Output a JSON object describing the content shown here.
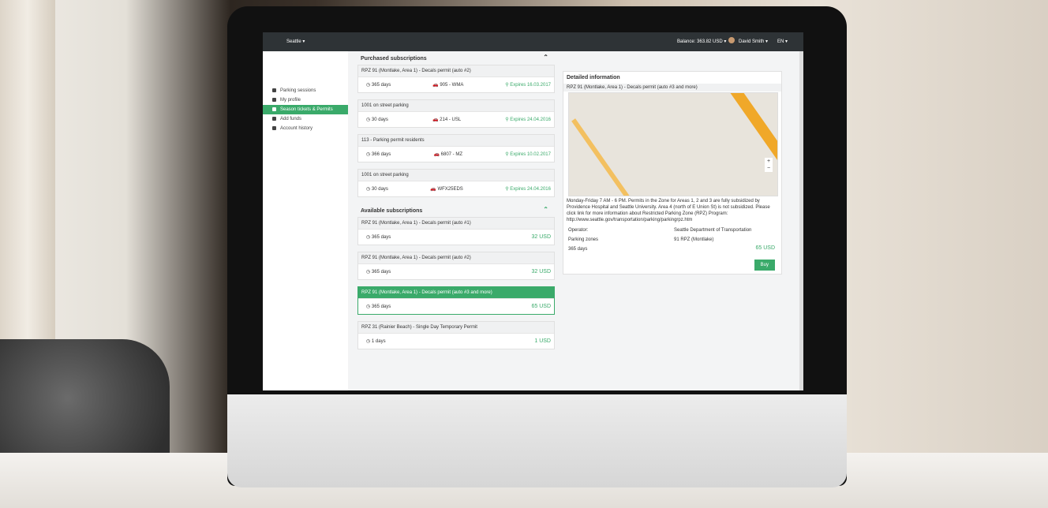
{
  "topbar": {
    "balance": "Balance: 363.82 USD ▾",
    "user": "David Smith ▾",
    "lang": "EN ▾",
    "city": "Seattle ▾"
  },
  "sidebar": {
    "items": [
      {
        "label": "Parking sessions",
        "icon": "car-icon"
      },
      {
        "label": "My profile",
        "icon": "user-icon"
      },
      {
        "label": "Season tickets & Permits",
        "icon": "ticket-icon",
        "active": true
      },
      {
        "label": "Add funds",
        "icon": "money-icon"
      },
      {
        "label": "Account history",
        "icon": "calendar-icon"
      }
    ]
  },
  "purchased": {
    "title": "Purchased subscriptions",
    "items": [
      {
        "name": "RPZ 91 (Montlake, Area 1) - Decals permit (auto #2)",
        "days": "365 days",
        "plate": "905 - WMA",
        "exp": "Expires 16.03.2017"
      },
      {
        "name": "1001 on street parking",
        "days": "30 days",
        "plate": "214 - USL",
        "exp": "Expires 24.04.2016"
      },
      {
        "name": "113 - Parking permit residents",
        "days": "366 days",
        "plate": "6807 - MZ",
        "exp": "Expires 10.02.2017"
      },
      {
        "name": "1001 on street parking",
        "days": "30 days",
        "plate": "WFX25EDS",
        "exp": "Expires 24.04.2016"
      }
    ]
  },
  "available": {
    "title": "Available subscriptions",
    "items": [
      {
        "name": "RPZ 91 (Montlake, Area 1) - Decals permit (auto #1)",
        "days": "365 days",
        "price": "32 USD"
      },
      {
        "name": "RPZ 91 (Montlake, Area 1) - Decals permit (auto #2)",
        "days": "365 days",
        "price": "32 USD"
      },
      {
        "name": "RPZ 91 (Montlake, Area 1) - Decals permit (auto #3 and more)",
        "days": "365 days",
        "price": "65 USD",
        "selected": true
      },
      {
        "name": "RPZ 31 (Rainier Beach) - Single Day Temporary Permit",
        "days": "1 days",
        "price": "1 USD"
      }
    ]
  },
  "detail": {
    "title": "Detailed information",
    "subtitle": "RPZ 91 (Montlake, Area 1) - Decals permit (auto #3 and more)",
    "description": "Monday-Friday 7 AM - 6 PM. Permits in the Zone for Areas 1, 2 and 3 are fully subsidized by Providence Hospital and Seattle University. Area 4 (north of E Union St) is not subsidized. Please click link for more information about Restricted Parking Zone (RPZ) Program: http://www.seattle.gov/transportation/parking/parkingrpz.htm",
    "operator_label": "Operator:",
    "operator": "Seattle Department of Transportation",
    "zones_label": "Parking zones",
    "zones": "91 RPZ (Montlake)",
    "days": "365 days",
    "price": "65 USD",
    "buy": "Buy"
  }
}
